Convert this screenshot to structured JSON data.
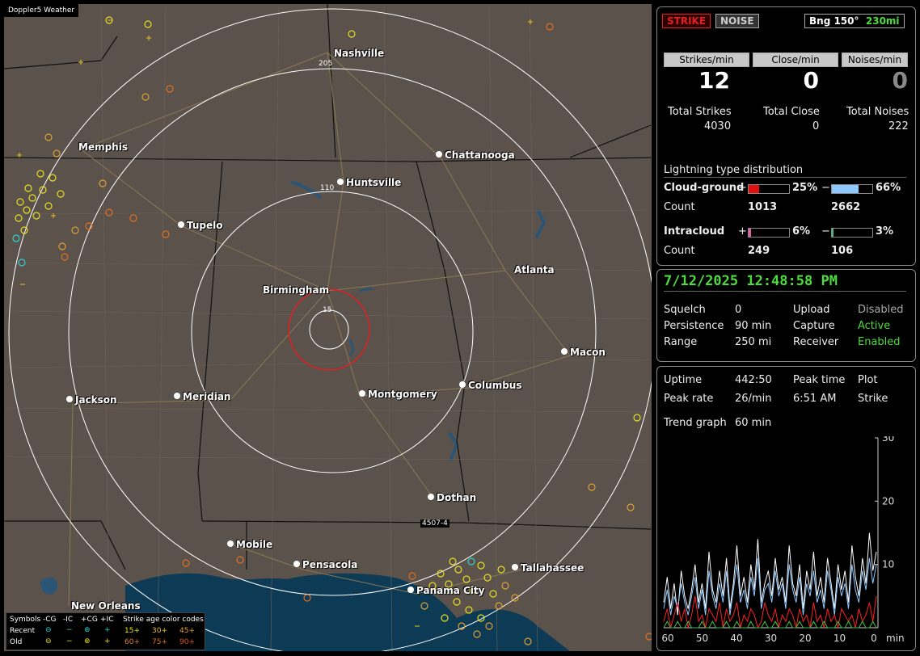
{
  "app": {
    "brand": "Doppler5 Weather"
  },
  "map": {
    "cities": [
      {
        "name": "Nashville"
      },
      {
        "name": "Memphis"
      },
      {
        "name": "Chattanooga"
      },
      {
        "name": "Huntsville"
      },
      {
        "name": "Tupelo"
      },
      {
        "name": "Atlanta"
      },
      {
        "name": "Birmingham"
      },
      {
        "name": "Macon"
      },
      {
        "name": "Jackson"
      },
      {
        "name": "Meridian"
      },
      {
        "name": "Montgomery"
      },
      {
        "name": "Columbus"
      },
      {
        "name": "Dothan"
      },
      {
        "name": "Mobile"
      },
      {
        "name": "Pensacola"
      },
      {
        "name": "Tallahassee"
      },
      {
        "name": "Panama City"
      },
      {
        "name": "New Orleans"
      }
    ],
    "ring_labels": [
      "205",
      "110",
      "15"
    ],
    "marker_label": "4507-4"
  },
  "legend": {
    "symbols": "Symbols",
    "headers": [
      "-CG",
      "-IC",
      "+CG",
      "+IC"
    ],
    "recent": "Recent",
    "old": "Old",
    "age_title": "Strike age color codes",
    "recent_ages": [
      "15+",
      "30+",
      "45+"
    ],
    "old_ages": [
      "60+",
      "75+",
      "90+"
    ]
  },
  "status": {
    "strike_button": "STRIKE",
    "noise_button": "NOISE",
    "bearing": "Bng 150°",
    "distance": "230mi"
  },
  "rates": {
    "strikes_label": "Strikes/min",
    "strikes_value": "12",
    "close_label": "Close/min",
    "close_value": "0",
    "noises_label": "Noises/min",
    "noises_value": "0"
  },
  "totals": {
    "strikes_label": "Total Strikes",
    "strikes_value": "4030",
    "close_label": "Total Close",
    "close_value": "0",
    "noises_label": "Total Noises",
    "noises_value": "222"
  },
  "distribution": {
    "title": "Lightning type distribution",
    "cg_label": "Cloud-ground",
    "cg_pos_sign": "+",
    "cg_pos_pct": "25%",
    "cg_pos_frac": 0.25,
    "cg_neg_sign": "−",
    "cg_neg_pct": "66%",
    "cg_neg_frac": 0.66,
    "count_label": "Count",
    "cg_pos_count": "1013",
    "cg_neg_count": "2662",
    "ic_label": "Intracloud",
    "ic_pos_sign": "+",
    "ic_pos_pct": "6%",
    "ic_pos_frac": 0.06,
    "ic_neg_sign": "−",
    "ic_neg_pct": "3%",
    "ic_neg_frac": 0.03,
    "ic_pos_count": "249",
    "ic_neg_count": "106"
  },
  "settings": {
    "datetime": "7/12/2025 12:48:58 PM",
    "squelch_label": "Squelch",
    "squelch_value": "0",
    "upload_label": "Upload",
    "upload_value": "Disabled",
    "persistence_label": "Persistence",
    "persistence_value": "90 min",
    "capture_label": "Capture",
    "capture_value": "Active",
    "range_label": "Range",
    "range_value": "250 mi",
    "receiver_label": "Receiver",
    "receiver_value": "Enabled"
  },
  "stats": {
    "uptime_label": "Uptime",
    "uptime_value": "442:50",
    "peaktime_label": "Peak time",
    "plot_label": "Plot",
    "peakrate_label": "Peak rate",
    "peakrate_value": "26/min",
    "peaktime_value": "6:51 AM",
    "plot_value": "Strike",
    "trend_label": "Trend graph",
    "trend_value": "60 min"
  },
  "chart_data": {
    "type": "line",
    "x_ticks": [
      "60",
      "50",
      "40",
      "30",
      "20",
      "10",
      "0"
    ],
    "x_unit": "min",
    "y_ticks": [
      "30",
      "20",
      "10"
    ],
    "ylim": [
      0,
      30
    ],
    "series": [
      {
        "color": "#ffffff",
        "values": [
          4,
          8,
          3,
          7,
          2,
          9,
          5,
          3,
          6,
          10,
          4,
          7,
          3,
          12,
          6,
          4,
          9,
          5,
          11,
          3,
          7,
          13,
          5,
          8,
          4,
          10,
          6,
          14,
          4,
          7,
          9,
          5,
          11,
          6,
          8,
          4,
          13,
          7,
          5,
          10,
          3,
          9,
          6,
          12,
          5,
          8,
          4,
          11,
          7,
          3,
          10,
          6,
          9,
          4,
          13,
          8,
          5,
          11,
          7,
          15,
          9,
          12
        ]
      },
      {
        "color": "#8ec8ff",
        "values": [
          3,
          6,
          2,
          5,
          3,
          7,
          4,
          2,
          5,
          8,
          3,
          6,
          2,
          9,
          5,
          3,
          7,
          4,
          9,
          2,
          6,
          10,
          4,
          6,
          3,
          8,
          5,
          11,
          3,
          6,
          7,
          4,
          9,
          5,
          7,
          3,
          10,
          6,
          4,
          8,
          2,
          7,
          5,
          9,
          4,
          6,
          3,
          9,
          6,
          2,
          8,
          5,
          7,
          3,
          10,
          6,
          4,
          9,
          6,
          11,
          7,
          10
        ]
      },
      {
        "color": "#ff2020",
        "values": [
          1,
          3,
          0,
          2,
          4,
          1,
          3,
          0,
          2,
          5,
          1,
          2,
          0,
          3,
          2,
          1,
          4,
          0,
          3,
          1,
          2,
          4,
          0,
          2,
          1,
          3,
          2,
          0,
          1,
          4,
          2,
          1,
          3,
          0,
          2,
          1,
          3,
          2,
          0,
          3,
          1,
          2,
          0,
          4,
          1,
          2,
          0,
          3,
          1,
          2,
          0,
          3,
          2,
          1,
          2,
          0,
          3,
          1,
          2,
          4,
          1,
          5
        ]
      },
      {
        "color": "#40c040",
        "values": [
          0,
          1,
          0,
          0,
          1,
          0,
          0,
          1,
          0,
          0,
          0,
          1,
          0,
          0,
          1,
          0,
          0,
          0,
          1,
          0,
          0,
          1,
          0,
          0,
          0,
          1,
          0,
          0,
          0,
          1,
          0,
          0,
          1,
          0,
          0,
          0,
          1,
          0,
          0,
          1,
          0,
          0,
          0,
          1,
          0,
          0,
          1,
          0,
          0,
          0,
          1,
          0,
          0,
          1,
          0,
          0,
          0,
          1,
          0,
          0,
          1,
          0
        ]
      }
    ]
  }
}
